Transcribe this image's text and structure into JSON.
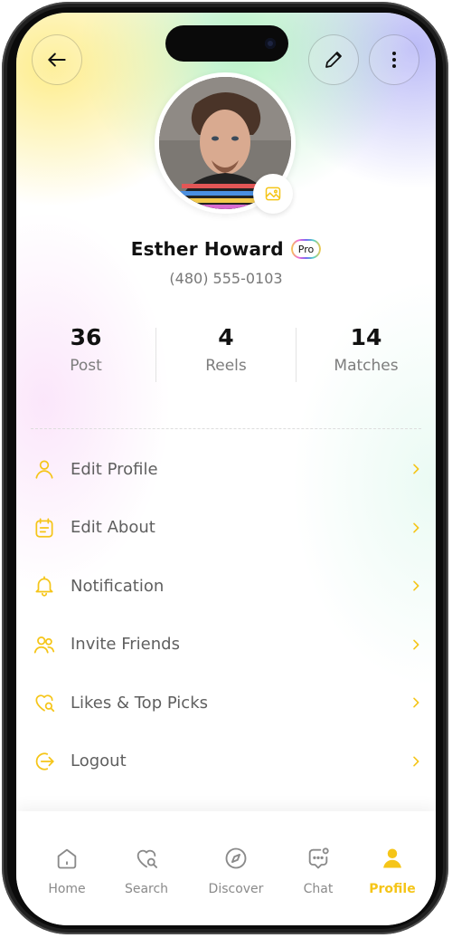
{
  "profile": {
    "name": "Esther Howard",
    "badge": "Pro",
    "phone": "(480) 555-0103"
  },
  "stats": [
    {
      "value": "36",
      "label": "Post"
    },
    {
      "value": "4",
      "label": "Reels"
    },
    {
      "value": "14",
      "label": "Matches"
    }
  ],
  "menu": [
    {
      "label": "Edit Profile",
      "icon": "user-icon"
    },
    {
      "label": "Edit About",
      "icon": "calendar-note-icon"
    },
    {
      "label": "Notification",
      "icon": "bell-icon"
    },
    {
      "label": "Invite Friends",
      "icon": "users-icon"
    },
    {
      "label": "Likes & Top Picks",
      "icon": "heart-search-icon"
    },
    {
      "label": "Logout",
      "icon": "logout-icon"
    }
  ],
  "nav": [
    {
      "label": "Home",
      "icon": "home-icon"
    },
    {
      "label": "Search",
      "icon": "heart-search-icon"
    },
    {
      "label": "Discover",
      "icon": "compass-icon"
    },
    {
      "label": "Chat",
      "icon": "chat-icon"
    },
    {
      "label": "Profile",
      "icon": "profile-icon",
      "active": true
    }
  ],
  "colors": {
    "accent": "#f5c518",
    "text_primary": "#111111",
    "text_secondary": "#777777"
  }
}
